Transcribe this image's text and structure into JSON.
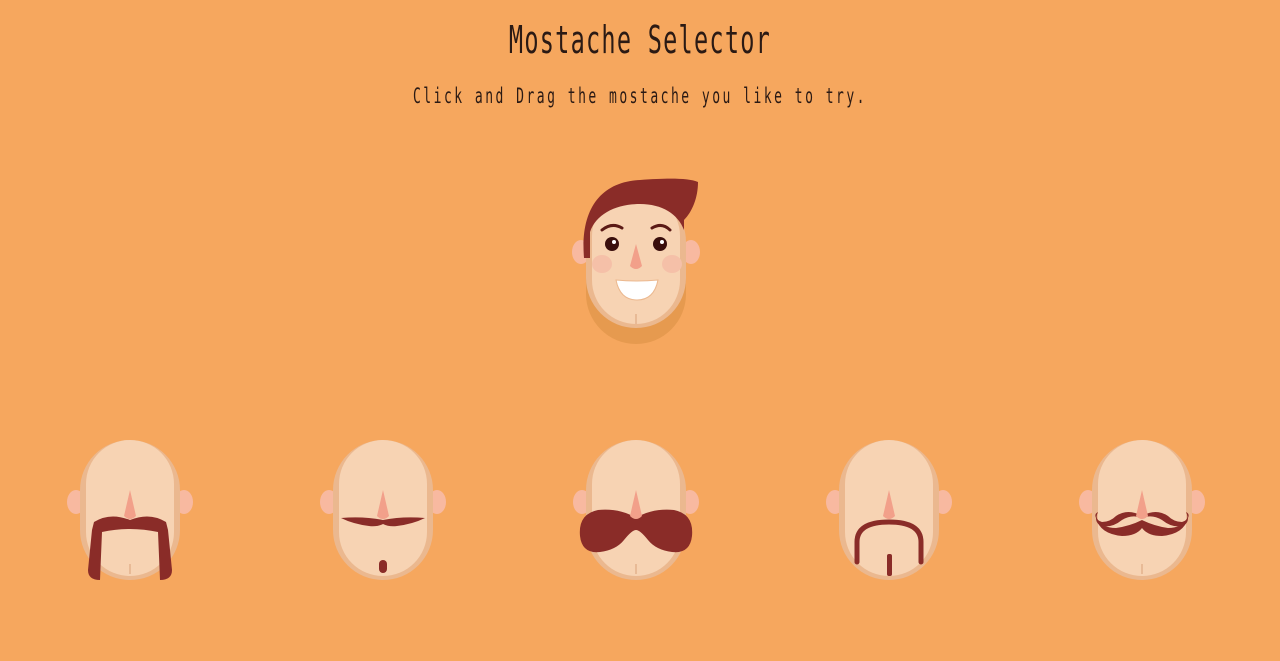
{
  "page": {
    "title": "Mostache Selector",
    "subtitle": "Click and Drag the mostache you like to try."
  },
  "colors": {
    "background": "#f6a75e",
    "skin": "#f7d3b3",
    "skin_shadow": "#ebb88f",
    "ear": "#f8b9a0",
    "nose": "#f2a08a",
    "hair": "#8a2c28",
    "mustache": "#8a2c28"
  },
  "preview_face": {
    "name": "preview-face",
    "icon": "smiling-man-face-icon"
  },
  "mustaches": [
    {
      "name": "horseshoe-mustache",
      "icon": "horseshoe-mustache-icon"
    },
    {
      "name": "pencil-mustache-with-soul-patch",
      "icon": "pencil-mustache-icon"
    },
    {
      "name": "walrus-mustache",
      "icon": "walrus-mustache-icon"
    },
    {
      "name": "goatee-mustache",
      "icon": "goatee-mustache-icon"
    },
    {
      "name": "handlebar-mustache",
      "icon": "handlebar-mustache-icon"
    }
  ]
}
